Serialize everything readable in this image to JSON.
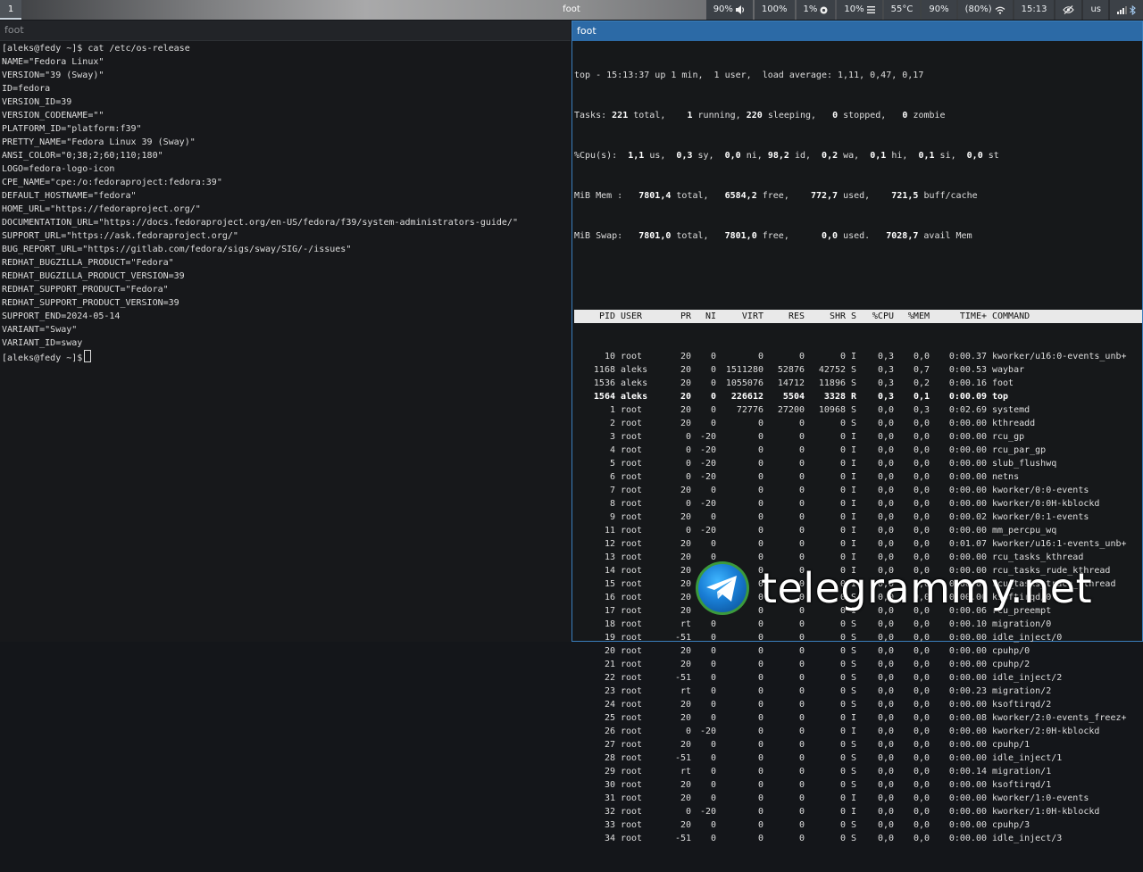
{
  "bar": {
    "workspace": "1",
    "title": "foot",
    "modules": {
      "volume": "90%",
      "brightness": "100%",
      "cpu": "1%",
      "memory": "10%",
      "temperature": "55°C",
      "battery": "90%",
      "wifi": "(80%)",
      "clock": "15:13",
      "layout": "us"
    }
  },
  "left_pane": {
    "title": "foot",
    "lines": [
      "[aleks@fedy ~]$ cat /etc/os-release",
      "NAME=\"Fedora Linux\"",
      "VERSION=\"39 (Sway)\"",
      "ID=fedora",
      "VERSION_ID=39",
      "VERSION_CODENAME=\"\"",
      "PLATFORM_ID=\"platform:f39\"",
      "PRETTY_NAME=\"Fedora Linux 39 (Sway)\"",
      "ANSI_COLOR=\"0;38;2;60;110;180\"",
      "LOGO=fedora-logo-icon",
      "CPE_NAME=\"cpe:/o:fedoraproject:fedora:39\"",
      "DEFAULT_HOSTNAME=\"fedora\"",
      "HOME_URL=\"https://fedoraproject.org/\"",
      "DOCUMENTATION_URL=\"https://docs.fedoraproject.org/en-US/fedora/f39/system-administrators-guide/\"",
      "SUPPORT_URL=\"https://ask.fedoraproject.org/\"",
      "BUG_REPORT_URL=\"https://gitlab.com/fedora/sigs/sway/SIG/-/issues\"",
      "REDHAT_BUGZILLA_PRODUCT=\"Fedora\"",
      "REDHAT_BUGZILLA_PRODUCT_VERSION=39",
      "REDHAT_SUPPORT_PRODUCT=\"Fedora\"",
      "REDHAT_SUPPORT_PRODUCT_VERSION=39",
      "SUPPORT_END=2024-05-14",
      "VARIANT=\"Sway\"",
      "VARIANT_ID=sway"
    ],
    "prompt": "[aleks@fedy ~]$"
  },
  "right_pane": {
    "title": "foot",
    "summary": {
      "line1": "top - 15:13:37 up 1 min,  1 user,  load average: 1,11, 0,47, 0,17",
      "tasks": {
        "label": "Tasks:",
        "total": "221",
        "running": "1",
        "sleeping": "220",
        "stopped": "0",
        "zombie": "0"
      },
      "cpu": {
        "label": "%Cpu(s):",
        "us": "1,1",
        "sy": "0,3",
        "ni": "0,0",
        "id": "98,2",
        "wa": "0,2",
        "hi": "0,1",
        "si": "0,1",
        "st": "0,0"
      },
      "mem": {
        "label": "MiB Mem :",
        "total": "7801,4",
        "free": "6584,2",
        "used": "772,7",
        "buff": "721,5"
      },
      "swap": {
        "label": "MiB Swap:",
        "total": "7801,0",
        "free": "7801,0",
        "used": "0,0",
        "avail": "7028,7"
      },
      "words": {
        "total": "total,",
        "running": "running,",
        "sleeping": "sleeping,",
        "stopped": "stopped,",
        "zombie": "zombie",
        "us": "us,",
        "sy": "sy,",
        "ni": "ni,",
        "id": "id,",
        "wa": "wa,",
        "hi": "hi,",
        "si": "si,",
        "st": "st",
        "free": "free,",
        "used": "used,",
        "used_dot": "used.",
        "buff": "buff/cache",
        "avail": "avail Mem"
      }
    },
    "columns": [
      "PID",
      "USER",
      "PR",
      "NI",
      "VIRT",
      "RES",
      "SHR",
      "S",
      "%CPU",
      "%MEM",
      "TIME+",
      "COMMAND"
    ],
    "processes": [
      [
        "10",
        "root",
        "20",
        "0",
        "0",
        "0",
        "0",
        "I",
        "0,3",
        "0,0",
        "0:00.37",
        "kworker/u16:0-events_unb+"
      ],
      [
        "1168",
        "aleks",
        "20",
        "0",
        "1511280",
        "52876",
        "42752",
        "S",
        "0,3",
        "0,7",
        "0:00.53",
        "waybar"
      ],
      [
        "1536",
        "aleks",
        "20",
        "0",
        "1055076",
        "14712",
        "11896",
        "S",
        "0,3",
        "0,2",
        "0:00.16",
        "foot"
      ],
      [
        "1564",
        "aleks",
        "20",
        "0",
        "226612",
        "5504",
        "3328",
        "R",
        "0,3",
        "0,1",
        "0:00.09",
        "top"
      ],
      [
        "1",
        "root",
        "20",
        "0",
        "72776",
        "27200",
        "10968",
        "S",
        "0,0",
        "0,3",
        "0:02.69",
        "systemd"
      ],
      [
        "2",
        "root",
        "20",
        "0",
        "0",
        "0",
        "0",
        "S",
        "0,0",
        "0,0",
        "0:00.00",
        "kthreadd"
      ],
      [
        "3",
        "root",
        "0",
        "-20",
        "0",
        "0",
        "0",
        "I",
        "0,0",
        "0,0",
        "0:00.00",
        "rcu_gp"
      ],
      [
        "4",
        "root",
        "0",
        "-20",
        "0",
        "0",
        "0",
        "I",
        "0,0",
        "0,0",
        "0:00.00",
        "rcu_par_gp"
      ],
      [
        "5",
        "root",
        "0",
        "-20",
        "0",
        "0",
        "0",
        "I",
        "0,0",
        "0,0",
        "0:00.00",
        "slub_flushwq"
      ],
      [
        "6",
        "root",
        "0",
        "-20",
        "0",
        "0",
        "0",
        "I",
        "0,0",
        "0,0",
        "0:00.00",
        "netns"
      ],
      [
        "7",
        "root",
        "20",
        "0",
        "0",
        "0",
        "0",
        "I",
        "0,0",
        "0,0",
        "0:00.00",
        "kworker/0:0-events"
      ],
      [
        "8",
        "root",
        "0",
        "-20",
        "0",
        "0",
        "0",
        "I",
        "0,0",
        "0,0",
        "0:00.00",
        "kworker/0:0H-kblockd"
      ],
      [
        "9",
        "root",
        "20",
        "0",
        "0",
        "0",
        "0",
        "I",
        "0,0",
        "0,0",
        "0:00.02",
        "kworker/0:1-events"
      ],
      [
        "11",
        "root",
        "0",
        "-20",
        "0",
        "0",
        "0",
        "I",
        "0,0",
        "0,0",
        "0:00.00",
        "mm_percpu_wq"
      ],
      [
        "12",
        "root",
        "20",
        "0",
        "0",
        "0",
        "0",
        "I",
        "0,0",
        "0,0",
        "0:01.07",
        "kworker/u16:1-events_unb+"
      ],
      [
        "13",
        "root",
        "20",
        "0",
        "0",
        "0",
        "0",
        "I",
        "0,0",
        "0,0",
        "0:00.00",
        "rcu_tasks_kthread"
      ],
      [
        "14",
        "root",
        "20",
        "0",
        "0",
        "0",
        "0",
        "I",
        "0,0",
        "0,0",
        "0:00.00",
        "rcu_tasks_rude_kthread"
      ],
      [
        "15",
        "root",
        "20",
        "0",
        "0",
        "0",
        "0",
        "I",
        "0,0",
        "0,0",
        "0:00.00",
        "rcu_tasks_trace_kthread"
      ],
      [
        "16",
        "root",
        "20",
        "0",
        "0",
        "0",
        "0",
        "S",
        "0,0",
        "0,0",
        "0:00.00",
        "ksoftirqd/0"
      ],
      [
        "17",
        "root",
        "20",
        "0",
        "0",
        "0",
        "0",
        "I",
        "0,0",
        "0,0",
        "0:00.06",
        "rcu_preempt"
      ],
      [
        "18",
        "root",
        "rt",
        "0",
        "0",
        "0",
        "0",
        "S",
        "0,0",
        "0,0",
        "0:00.10",
        "migration/0"
      ],
      [
        "19",
        "root",
        "-51",
        "0",
        "0",
        "0",
        "0",
        "S",
        "0,0",
        "0,0",
        "0:00.00",
        "idle_inject/0"
      ],
      [
        "20",
        "root",
        "20",
        "0",
        "0",
        "0",
        "0",
        "S",
        "0,0",
        "0,0",
        "0:00.00",
        "cpuhp/0"
      ],
      [
        "21",
        "root",
        "20",
        "0",
        "0",
        "0",
        "0",
        "S",
        "0,0",
        "0,0",
        "0:00.00",
        "cpuhp/2"
      ],
      [
        "22",
        "root",
        "-51",
        "0",
        "0",
        "0",
        "0",
        "S",
        "0,0",
        "0,0",
        "0:00.00",
        "idle_inject/2"
      ],
      [
        "23",
        "root",
        "rt",
        "0",
        "0",
        "0",
        "0",
        "S",
        "0,0",
        "0,0",
        "0:00.23",
        "migration/2"
      ],
      [
        "24",
        "root",
        "20",
        "0",
        "0",
        "0",
        "0",
        "S",
        "0,0",
        "0,0",
        "0:00.00",
        "ksoftirqd/2"
      ],
      [
        "25",
        "root",
        "20",
        "0",
        "0",
        "0",
        "0",
        "I",
        "0,0",
        "0,0",
        "0:00.08",
        "kworker/2:0-events_freez+"
      ],
      [
        "26",
        "root",
        "0",
        "-20",
        "0",
        "0",
        "0",
        "I",
        "0,0",
        "0,0",
        "0:00.00",
        "kworker/2:0H-kblockd"
      ],
      [
        "27",
        "root",
        "20",
        "0",
        "0",
        "0",
        "0",
        "S",
        "0,0",
        "0,0",
        "0:00.00",
        "cpuhp/1"
      ],
      [
        "28",
        "root",
        "-51",
        "0",
        "0",
        "0",
        "0",
        "S",
        "0,0",
        "0,0",
        "0:00.00",
        "idle_inject/1"
      ],
      [
        "29",
        "root",
        "rt",
        "0",
        "0",
        "0",
        "0",
        "S",
        "0,0",
        "0,0",
        "0:00.14",
        "migration/1"
      ],
      [
        "30",
        "root",
        "20",
        "0",
        "0",
        "0",
        "0",
        "S",
        "0,0",
        "0,0",
        "0:00.00",
        "ksoftirqd/1"
      ],
      [
        "31",
        "root",
        "20",
        "0",
        "0",
        "0",
        "0",
        "I",
        "0,0",
        "0,0",
        "0:00.00",
        "kworker/1:0-events"
      ],
      [
        "32",
        "root",
        "0",
        "-20",
        "0",
        "0",
        "0",
        "I",
        "0,0",
        "0,0",
        "0:00.00",
        "kworker/1:0H-kblockd"
      ],
      [
        "33",
        "root",
        "20",
        "0",
        "0",
        "0",
        "0",
        "S",
        "0,0",
        "0,0",
        "0:00.00",
        "cpuhp/3"
      ],
      [
        "34",
        "root",
        "-51",
        "0",
        "0",
        "0",
        "0",
        "S",
        "0,0",
        "0,0",
        "0:00.00",
        "idle_inject/3"
      ]
    ],
    "highlight_pid": "1564"
  },
  "watermark": {
    "text": "telegrammy.net",
    "logo_icon": "telegram-plane-icon"
  },
  "colors": {
    "accent": "#2c6aa6",
    "border": "#3b7fbd",
    "terminal_bg": "#16181a",
    "header_bg": "#e9e9e9"
  }
}
